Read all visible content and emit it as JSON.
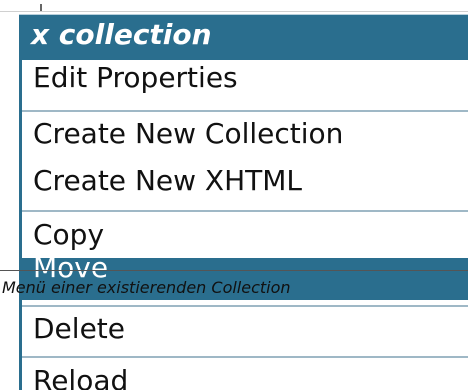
{
  "menu": {
    "title": "x collection",
    "items": [
      {
        "label": "Edit Properties",
        "group": 1
      },
      {
        "label": "Create New Collection",
        "group": 2
      },
      {
        "label": "Create New XHTML",
        "group": 2
      },
      {
        "label": "Copy",
        "group": 3
      },
      {
        "label": "Move",
        "group": 3,
        "highlighted": true
      },
      {
        "label": "Delete",
        "group": 4
      },
      {
        "label": "Reload",
        "group": 5
      }
    ]
  },
  "caption": "Menü einer existierenden Collection",
  "colors": {
    "header_bg": "#2a6e8e",
    "header_text": "#ffffff",
    "item_text": "#111111",
    "divider": "#9fb8c6",
    "highlight_bg": "#2a6e8e"
  }
}
